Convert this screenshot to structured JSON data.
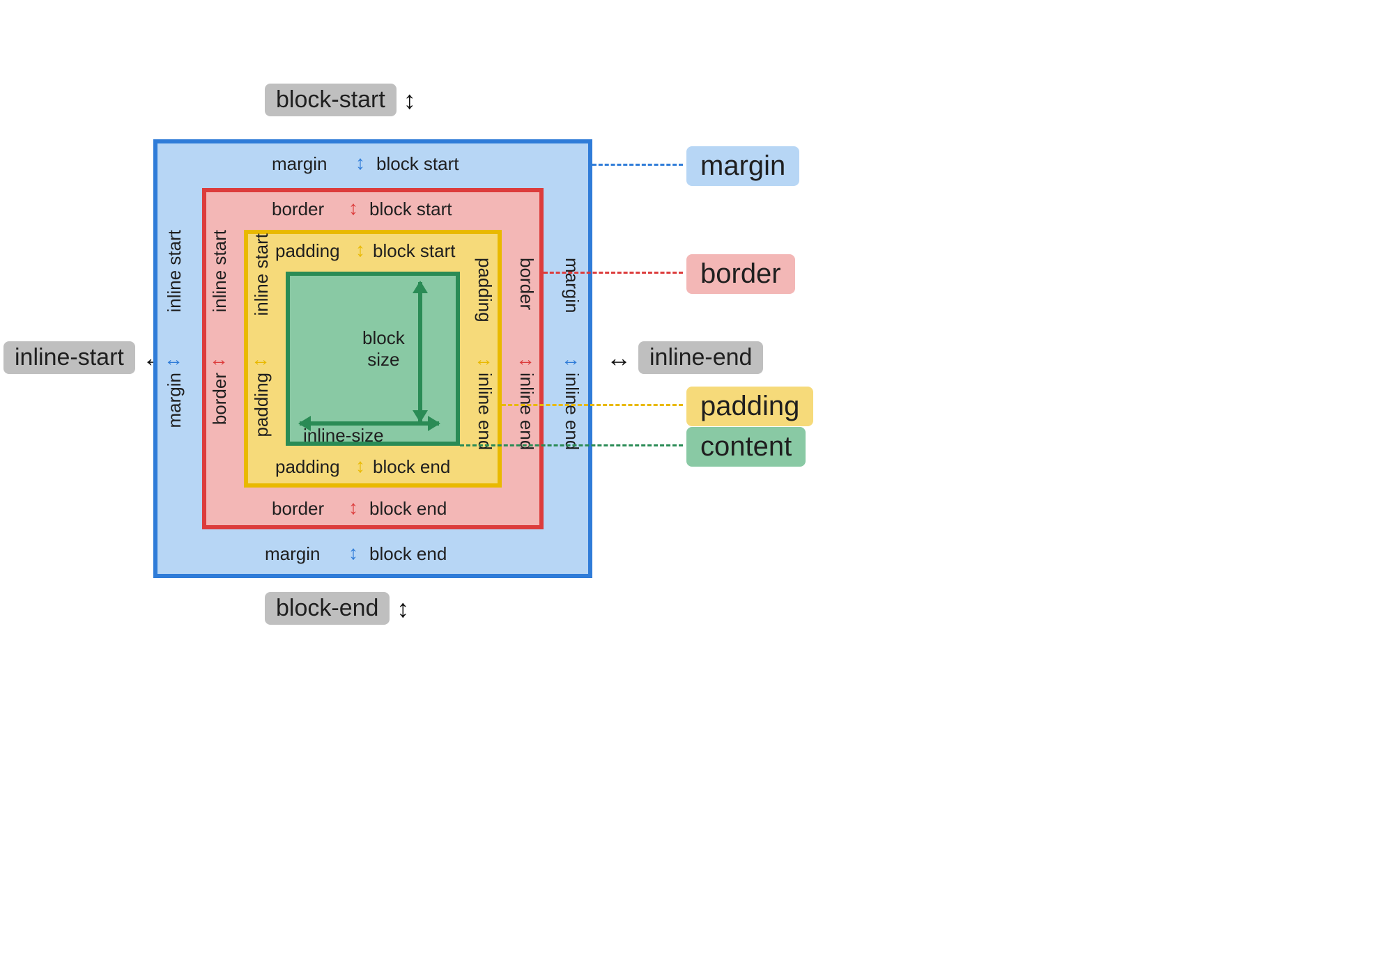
{
  "axes": {
    "block_start": "block-start",
    "block_end": "block-end",
    "inline_start": "inline-start",
    "inline_end": "inline-end"
  },
  "margin": {
    "top_left": "margin",
    "top_right": "block start",
    "bottom_left": "margin",
    "bottom_right": "block end",
    "left_top": "margin",
    "left_bottom": "inline start",
    "right_top": "margin",
    "right_bottom": "inline end"
  },
  "border": {
    "top_left": "border",
    "top_right": "block start",
    "bottom_left": "border",
    "bottom_right": "block end",
    "left_top": "border",
    "left_bottom": "inline start",
    "right_top": "border",
    "right_bottom": "inline end"
  },
  "padding": {
    "top_left": "padding",
    "top_right": "block start",
    "bottom_left": "padding",
    "bottom_right": "block end",
    "left_top": "padding",
    "left_bottom": "inline start",
    "right_top": "padding",
    "right_bottom": "inline end"
  },
  "content": {
    "block_size": "block\nsize",
    "inline_size": "inline-size"
  },
  "legend": {
    "margin": "margin",
    "border": "border",
    "padding": "padding",
    "content": "content"
  },
  "colors": {
    "ink": "#1f1f1f",
    "gray": "#bfbfbf",
    "margin_bg": "#b7d6f5",
    "margin_border": "#2f7cd8",
    "border_bg": "#f3b7b6",
    "border_border": "#dc3c3c",
    "padding_bg": "#f6da7a",
    "padding_border": "#e9b900",
    "content_bg": "#89c9a4",
    "content_border": "#2a8b55"
  }
}
